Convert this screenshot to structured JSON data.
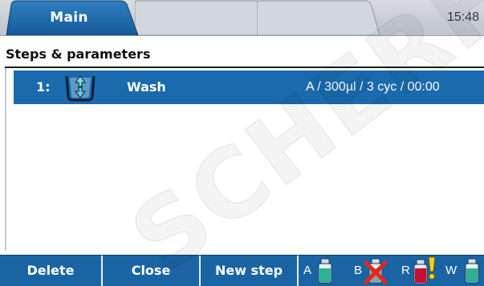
{
  "tabs": [
    {
      "label": "Main",
      "active": true
    },
    {
      "label": "",
      "active": false
    },
    {
      "label": "",
      "active": false
    }
  ],
  "clock": "15:48",
  "section": {
    "title": "Steps & parameters"
  },
  "steps": [
    {
      "number": "1:",
      "icon": "wash-vessel-icon",
      "name": "Wash",
      "params": "A / 300µl / 3 cyc / 00:00"
    }
  ],
  "buttons": {
    "delete": "Delete",
    "close": "Close",
    "new_step": "New step"
  },
  "bottles": [
    {
      "letter": "A",
      "color": "#2fb08f",
      "status": "ok"
    },
    {
      "letter": "B",
      "color": "#8fa0a8",
      "status": "missing"
    },
    {
      "letter": "R",
      "color": "#c8102e",
      "status": "warning"
    },
    {
      "letter": "W",
      "color": "#2fb08f",
      "status": "ok"
    }
  ],
  "watermark": "SCHERF",
  "colors": {
    "accent": "#1a6aad",
    "bar": "#1a64a4",
    "tab_active": "#1a64a4"
  }
}
